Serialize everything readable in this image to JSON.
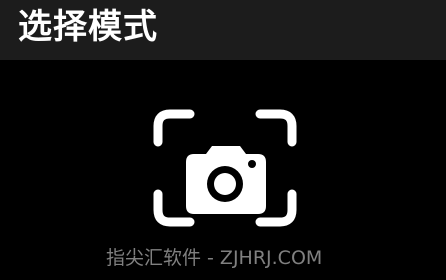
{
  "header": {
    "title": "选择模式"
  },
  "main": {
    "scan_icon": "camera-scan-icon"
  },
  "watermark": {
    "text": "指尖汇软件 - ZJHRJ.COM"
  },
  "colors": {
    "background": "#000000",
    "header_background": "#1c1c1c",
    "title_text": "#ffffff",
    "icon": "#ffffff",
    "watermark_text": "#969696"
  }
}
